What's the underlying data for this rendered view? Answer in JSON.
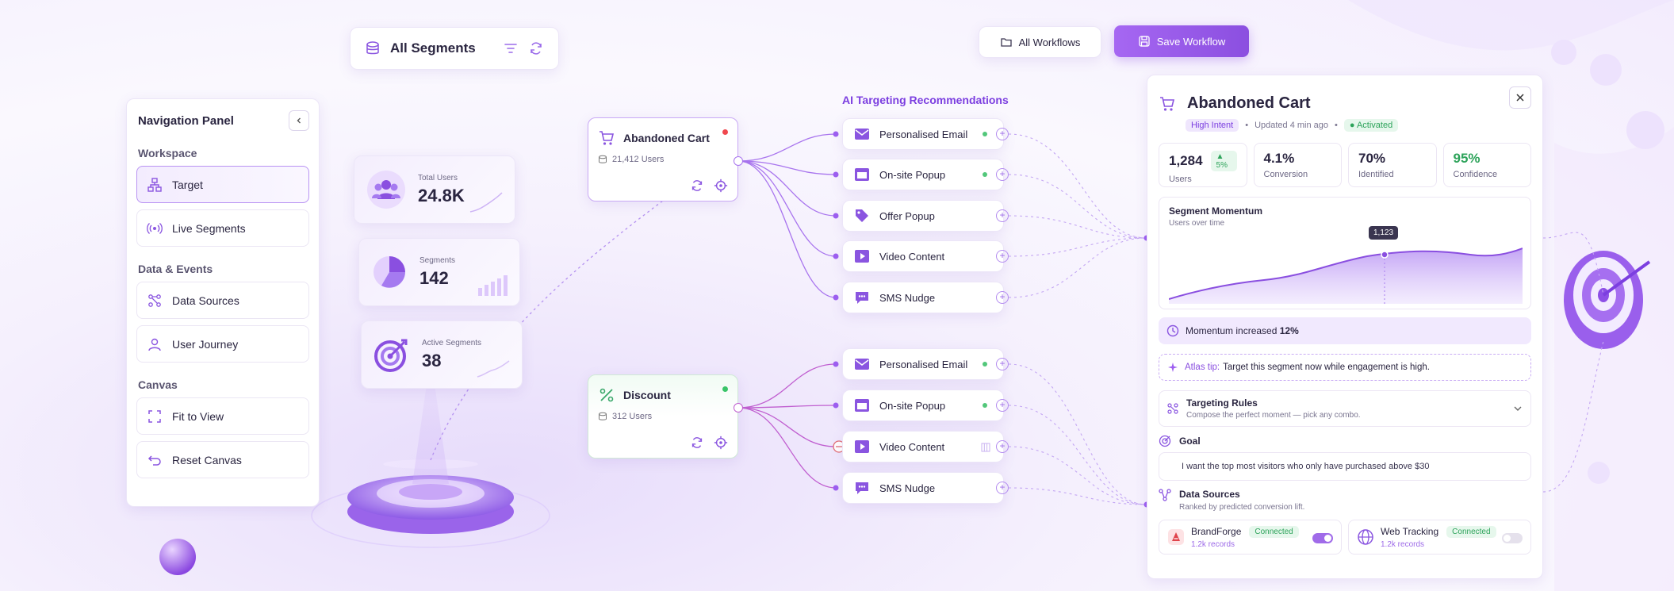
{
  "topbar": {
    "segments_label": "All Segments",
    "all_workflows_label": "All Workflows",
    "save_workflow_label": "Save Workflow"
  },
  "nav": {
    "title": "Navigation Panel",
    "sections": [
      {
        "heading": "Workspace",
        "items": [
          {
            "label": "Target",
            "icon": "sitemap-icon",
            "active": true
          },
          {
            "label": "Live Segments",
            "icon": "broadcast-icon"
          }
        ]
      },
      {
        "heading": "Data & Events",
        "items": [
          {
            "label": "Data Sources",
            "icon": "nodes-icon"
          },
          {
            "label": "User Journey",
            "icon": "user-icon"
          }
        ]
      },
      {
        "heading": "Canvas",
        "items": [
          {
            "label": "Fit to View",
            "icon": "expand-icon"
          },
          {
            "label": "Reset Canvas",
            "icon": "undo-icon"
          }
        ]
      }
    ]
  },
  "stats": [
    {
      "label": "Total Users",
      "value": "24.8K",
      "icon": "users-icon"
    },
    {
      "label": "Segments",
      "value": "142",
      "icon": "pie-icon"
    },
    {
      "label": "Active Segments",
      "value": "38",
      "icon": "target-icon"
    }
  ],
  "nodes": [
    {
      "title": "Abandoned Cart",
      "users": "21,412 Users",
      "status_color": "#f0484e",
      "icon": "cart-icon"
    },
    {
      "title": "Discount",
      "users": "312 Users",
      "status_color": "#39c468",
      "icon": "percent-icon"
    }
  ],
  "recommendations_title": "AI Targeting Recommendations",
  "recommendations_top": [
    {
      "label": "Personalised Email",
      "icon": "mail-icon",
      "status": "on"
    },
    {
      "label": "On-site Popup",
      "icon": "window-icon",
      "status": "on"
    },
    {
      "label": "Offer Popup",
      "icon": "tag-icon",
      "status": "off"
    },
    {
      "label": "Video Content",
      "icon": "play-icon",
      "status": "off"
    },
    {
      "label": "SMS Nudge",
      "icon": "sms-icon",
      "status": "off"
    }
  ],
  "recommendations_bottom": [
    {
      "label": "Personalised Email",
      "icon": "mail-icon",
      "status": "on"
    },
    {
      "label": "On-site Popup",
      "icon": "window-icon",
      "status": "on"
    },
    {
      "label": "Video Content",
      "icon": "play-icon",
      "status": "bars"
    },
    {
      "label": "SMS Nudge",
      "icon": "sms-icon",
      "status": "off"
    }
  ],
  "detail": {
    "title": "Abandoned Cart",
    "intent_tag": "High Intent",
    "updated": "Updated 4 min ago",
    "status_tag": "Activated",
    "metrics": [
      {
        "value": "1,284",
        "label": "Users",
        "delta": "▲ 5%"
      },
      {
        "value": "4.1%",
        "label": "Conversion"
      },
      {
        "value": "70%",
        "label": "Identified"
      },
      {
        "value": "95%",
        "label": "Confidence"
      }
    ],
    "momentum": {
      "title": "Segment Momentum",
      "subtitle": "Users over time",
      "peak_label": "1,123"
    },
    "banner_prefix": "Momentum increased ",
    "banner_value": "12%",
    "tip_label": "Atlas tip:",
    "tip_text": "Target this segment now while engagement is high.",
    "rules_title": "Targeting Rules",
    "rules_subtitle": "Compose the perfect moment — pick any combo.",
    "goal_title": "Goal",
    "goal_text": "I want the top most visitors who only have purchased above $30",
    "sources_title": "Data Sources",
    "sources_subtitle": "Ranked by predicted conversion lift.",
    "sources": [
      {
        "name": "BrandForge",
        "status": "Connected",
        "records": "1.2k records",
        "enabled": true
      },
      {
        "name": "Web Tracking",
        "status": "Connected",
        "records": "1.2k records",
        "enabled": false
      }
    ]
  },
  "colors": {
    "accent": "#9d5ff0",
    "connected": "#2da35a",
    "alert": "#f0484e"
  }
}
